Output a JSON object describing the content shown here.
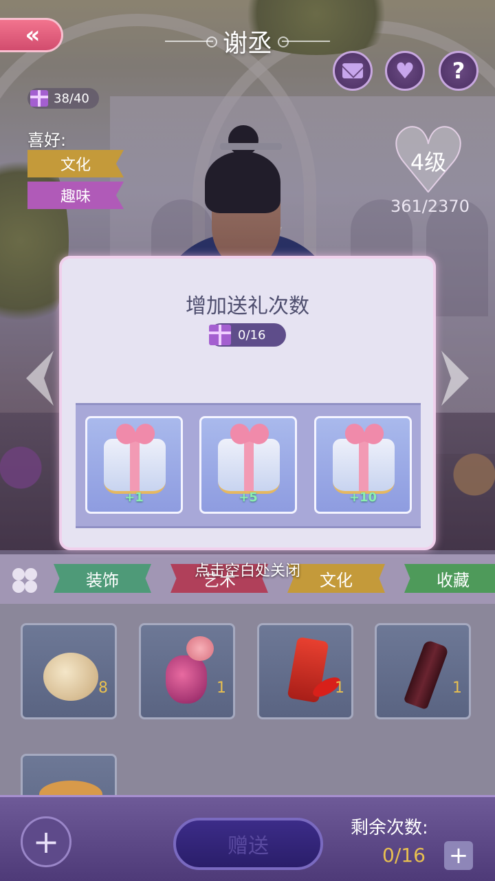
{
  "header": {
    "back_label": "«",
    "title": "谢丞",
    "mail_icon": "mail-icon",
    "heart_icon": "heart-icon",
    "help_label": "?"
  },
  "gift_counter": {
    "value": "38/40",
    "icon": "gift-icon"
  },
  "hobby": {
    "label": "喜好:",
    "tags": [
      "文化",
      "趣味"
    ]
  },
  "level": {
    "label": "4级",
    "progress": "361/2370"
  },
  "modal": {
    "title": "增加送礼次数",
    "count": "0/16",
    "options": [
      {
        "bonus": "+1"
      },
      {
        "bonus": "+5"
      },
      {
        "bonus": "+10"
      }
    ],
    "close_hint": "点击空白处关闭"
  },
  "tabs": [
    "装饰",
    "艺术",
    "文化",
    "收藏"
  ],
  "tab_colors": [
    "#4e9a78",
    "#b0405a",
    "#c49a3a",
    "#4e9a5a"
  ],
  "items": [
    {
      "icon": "sugar-bowl-icon",
      "qty": "8"
    },
    {
      "icon": "perfume-icon",
      "qty": "1"
    },
    {
      "icon": "spice-icon",
      "qty": "1"
    },
    {
      "icon": "wine-icon",
      "qty": "1"
    },
    {
      "icon": "croissant-icon",
      "qty": ""
    }
  ],
  "bottom": {
    "add_label": "+",
    "gift_button": "赠送",
    "remain_label": "剩余次数:",
    "remain_value": "0/16",
    "remain_plus": "+"
  }
}
